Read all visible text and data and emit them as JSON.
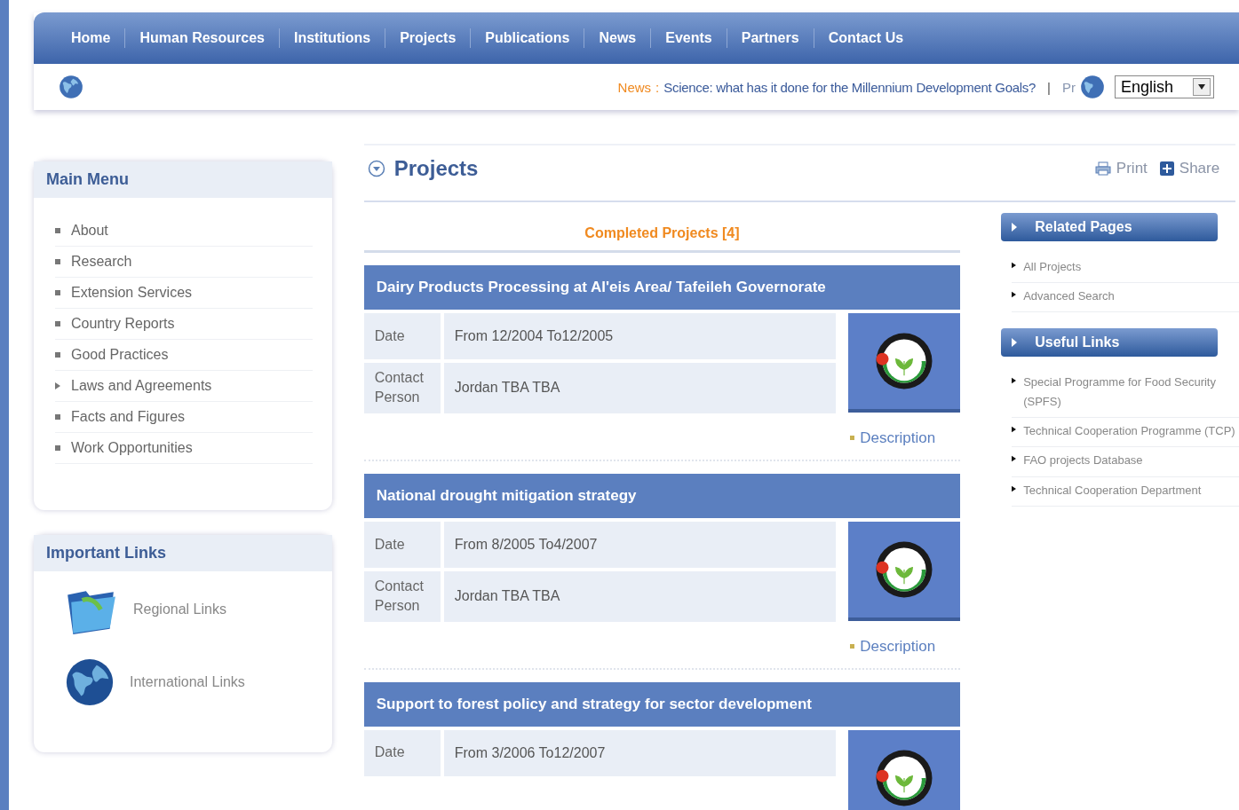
{
  "nav": [
    "Home",
    "Human Resources",
    "Institutions",
    "Projects",
    "Publications",
    "News",
    "Events",
    "Partners",
    "Contact Us"
  ],
  "ticker": {
    "label": "News",
    "separator": ":",
    "headline": "Science: what has it done for the Millennium Development Goals?",
    "divider": "|",
    "next": "Pr"
  },
  "language": {
    "value": "English"
  },
  "main_menu": {
    "title": "Main Menu",
    "items": [
      {
        "label": "About",
        "kind": "item"
      },
      {
        "label": "Research",
        "kind": "item"
      },
      {
        "label": "Extension Services",
        "kind": "item"
      },
      {
        "label": "Country Reports",
        "kind": "item"
      },
      {
        "label": "Good Practices",
        "kind": "item"
      },
      {
        "label": "Laws and Agreements",
        "kind": "submenu"
      },
      {
        "label": "Facts and Figures",
        "kind": "item"
      },
      {
        "label": "Work Opportunities",
        "kind": "item"
      }
    ]
  },
  "important_links": {
    "title": "Important Links",
    "items": [
      {
        "label": "Regional Links",
        "kind": "folder"
      },
      {
        "label": "International Links",
        "kind": "globe"
      }
    ]
  },
  "page": {
    "title": "Projects",
    "print": "Print",
    "share": "Share",
    "section": "Completed Projects [4]"
  },
  "projects": [
    {
      "title": "Dairy Products Processing at Al'eis Area/ Tafeileh Governorate",
      "date_label": "Date",
      "date": "From 12/2004  To12/2005",
      "contact_label": "Contact Person",
      "contact": "Jordan TBA TBA",
      "description": "Description"
    },
    {
      "title": "National drought mitigation strategy",
      "date_label": "Date",
      "date": "From 8/2005  To4/2007",
      "contact_label": "Contact Person",
      "contact": "Jordan TBA TBA",
      "description": "Description"
    },
    {
      "title": "Support to forest policy and strategy for sector development",
      "date_label": "Date",
      "date": "From 3/2006  To12/2007"
    }
  ],
  "related_pages": {
    "title": "Related Pages",
    "items": [
      "All Projects",
      "Advanced Search"
    ]
  },
  "useful_links": {
    "title": "Useful Links",
    "items": [
      "Special Programme for Food Security (SPFS)",
      "Technical Cooperation Programme (TCP)",
      "FAO projects Database",
      "Technical Cooperation Department"
    ]
  }
}
